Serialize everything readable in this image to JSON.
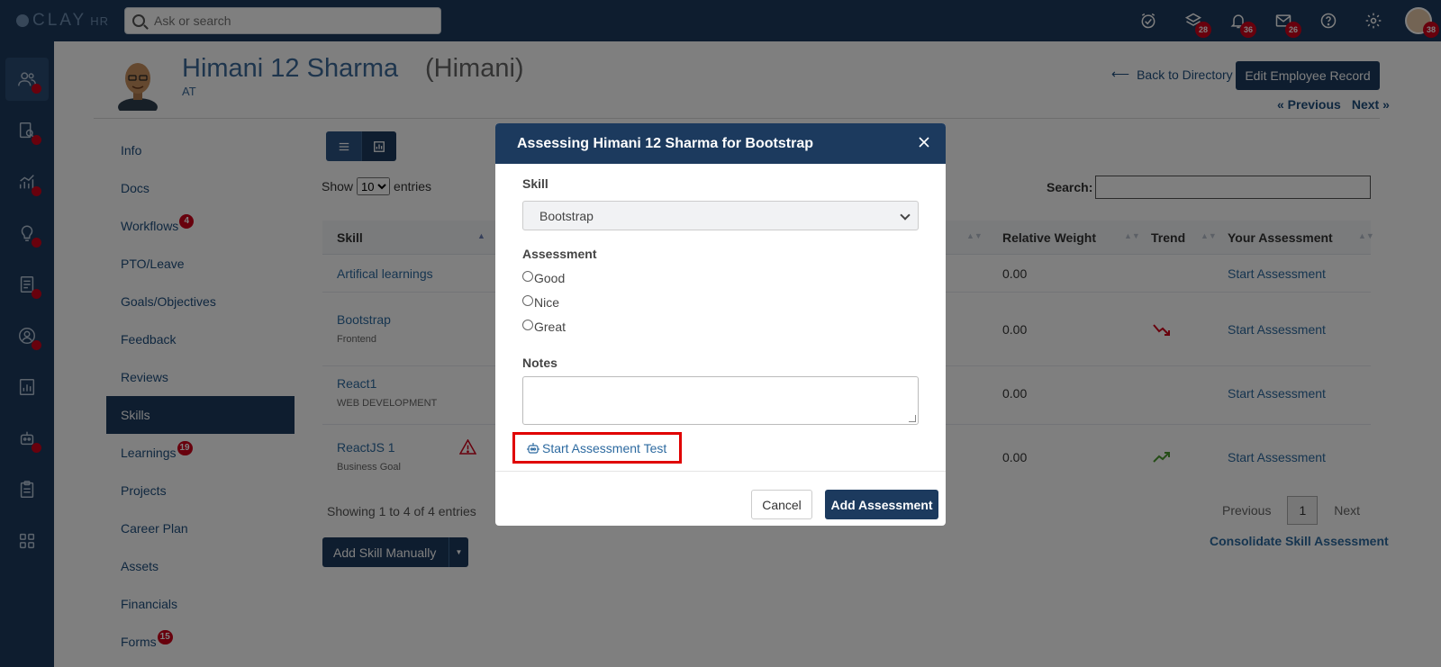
{
  "app": {
    "logo_main": "CLAY",
    "logo_sub": "HR"
  },
  "search": {
    "placeholder": "Ask or search"
  },
  "top_icons": [
    {
      "name": "tasks-icon",
      "badge": ""
    },
    {
      "name": "layers-icon",
      "badge": "28"
    },
    {
      "name": "bell-icon",
      "badge": "36"
    },
    {
      "name": "mail-icon",
      "badge": "26"
    },
    {
      "name": "help-icon",
      "badge": ""
    },
    {
      "name": "gear-icon",
      "badge": ""
    }
  ],
  "avatar_badge": "38",
  "profile": {
    "name": "Himani 12 Sharma",
    "nickname": "(Himani)",
    "code": "AT",
    "back_link": "Back to Directory",
    "edit_button": "Edit Employee Record",
    "previous": "« Previous",
    "next": "Next »"
  },
  "left_menu": [
    {
      "label": "Info",
      "badge": ""
    },
    {
      "label": "Docs",
      "badge": ""
    },
    {
      "label": "Workflows",
      "badge": "4"
    },
    {
      "label": "PTO/Leave",
      "badge": ""
    },
    {
      "label": "Goals/Objectives",
      "badge": ""
    },
    {
      "label": "Feedback",
      "badge": ""
    },
    {
      "label": "Reviews",
      "badge": ""
    },
    {
      "label": "Skills",
      "badge": "",
      "active": true
    },
    {
      "label": "Learnings",
      "badge": "19"
    },
    {
      "label": "Projects",
      "badge": ""
    },
    {
      "label": "Career Plan",
      "badge": ""
    },
    {
      "label": "Assets",
      "badge": ""
    },
    {
      "label": "Financials",
      "badge": ""
    },
    {
      "label": "Forms",
      "badge": "15"
    }
  ],
  "table": {
    "show_label": "Show",
    "entries_value": "10",
    "entries_label": "entries",
    "search_label": "Search:",
    "columns": {
      "skill": "Skill",
      "relative_weight": "Relative Weight",
      "trend": "Trend",
      "your_assessment": "Your Assessment"
    },
    "rows": [
      {
        "skill": "Artifical learnings",
        "sub": "",
        "weight": "0.00",
        "trend": "",
        "action": "Start Assessment",
        "warning": false
      },
      {
        "skill": "Bootstrap",
        "sub": "Frontend",
        "weight": "0.00",
        "trend": "down",
        "action": "Start Assessment",
        "warning": false
      },
      {
        "skill": "React1",
        "sub": "WEB DEVELOPMENT",
        "weight": "0.00",
        "trend": "",
        "action": "Start Assessment",
        "warning": false
      },
      {
        "skill": "ReactJS 1",
        "sub": "Business Goal",
        "weight": "0.00",
        "trend": "up",
        "action": "Start Assessment",
        "warning": true
      }
    ],
    "showing": "Showing 1 to 4 of 4 entries",
    "add_skill": "Add Skill Manually",
    "pager": {
      "previous": "Previous",
      "current": "1",
      "next": "Next"
    },
    "consolidate": "Consolidate Skill Assessment"
  },
  "modal": {
    "title": "Assessing Himani 12 Sharma for Bootstrap",
    "skill_label": "Skill",
    "skill_value": "Bootstrap",
    "assessment_label": "Assessment",
    "options": [
      "Good",
      "Nice",
      "Great"
    ],
    "notes_label": "Notes",
    "start_test": "Start Assessment Test",
    "cancel": "Cancel",
    "add": "Add Assessment"
  },
  "colors": {
    "navy": "#1c3a5e",
    "link": "#2d6aa0",
    "badge": "#d0021b",
    "highlight": "#e00000"
  }
}
